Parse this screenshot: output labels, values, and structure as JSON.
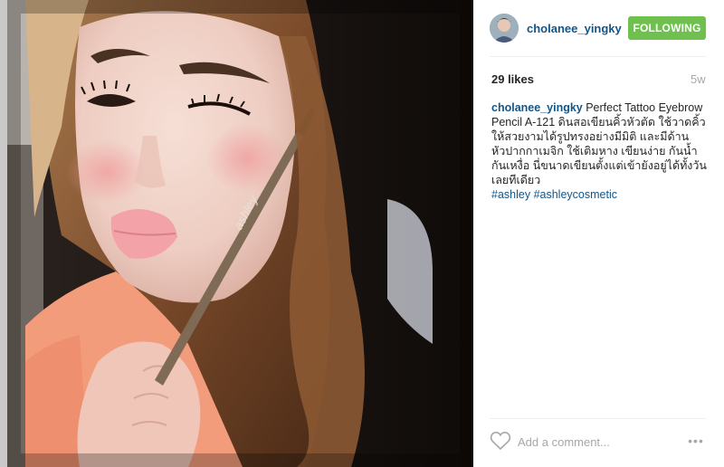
{
  "post": {
    "username": "cholanee_yingky",
    "follow_label": "FOLLOWING",
    "likes": "29 likes",
    "age": "5w",
    "caption": {
      "user": "cholanee_yingky",
      "text": " Perfect Tattoo Eyebrow Pencil A-121 ดินสอเขียนคิ้วหัวตัด ใช้วาดคิ้ว ให้สวยงามได้รูปทรงอย่างมีมิติ และมีด้านหัวปากกาเมจิก ใช้เติมหาง เขียนง่าย กันน้ำ กันเหงื่อ นี่ขนาดเขียนตั้งแต่เข้ายังอยู่ได้ทั้งวันเลยทีเดียว",
      "hashtags": [
        "#ashley",
        "#ashleycosmetic"
      ]
    },
    "comment_placeholder": "Add a comment...",
    "more_label": "•••"
  },
  "photo": {
    "product_text": "ashley"
  },
  "colors": {
    "link": "#125688",
    "follow_bg": "#70c050",
    "muted": "#a5a7aa"
  },
  "icons": {
    "like": "heart-outline-icon",
    "more": "ellipsis-icon"
  }
}
